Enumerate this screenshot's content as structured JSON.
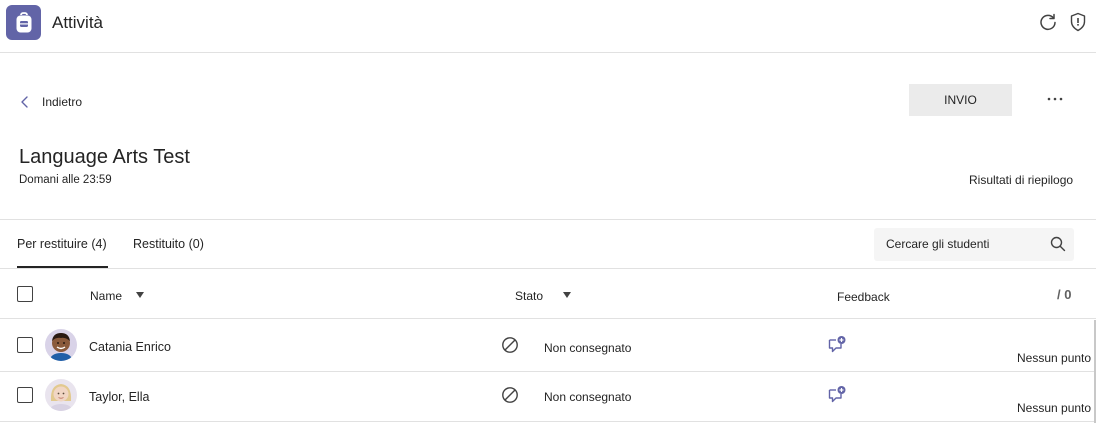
{
  "app": {
    "title": "Attività",
    "icon": "backpack-icon",
    "accent_color": "#6264a7"
  },
  "toolbar": {
    "refresh_icon": "refresh-icon",
    "shield_icon": "shield-icon"
  },
  "nav": {
    "back_label": "Indietro",
    "back_icon": "chevron-left-icon"
  },
  "actions": {
    "send_label": "INVIO",
    "more_icon": "more-horizontal-icon"
  },
  "assignment": {
    "title": "Language Arts Test",
    "due": "Domani alle 23:59",
    "summary_link": "Risultati di riepilogo"
  },
  "tabs": [
    {
      "label": "Per restituire (4)",
      "active": true
    },
    {
      "label": "Restituito (0)",
      "active": false
    }
  ],
  "search": {
    "placeholder": "Cercare gli studenti",
    "value": ""
  },
  "table": {
    "columns": {
      "name": "Name",
      "status": "Stato",
      "feedback": "Feedback",
      "points": "/ 0"
    },
    "rows": [
      {
        "name": "Catania Enrico",
        "status": "Non consegnato",
        "status_icon": "not-submitted-icon",
        "feedback_icon": "add-feedback-icon",
        "points": "Nessun punto"
      },
      {
        "name": "Taylor, Ella",
        "status": "Non consegnato",
        "status_icon": "not-submitted-icon",
        "feedback_icon": "add-feedback-icon",
        "points": "Nessun punto"
      }
    ]
  }
}
